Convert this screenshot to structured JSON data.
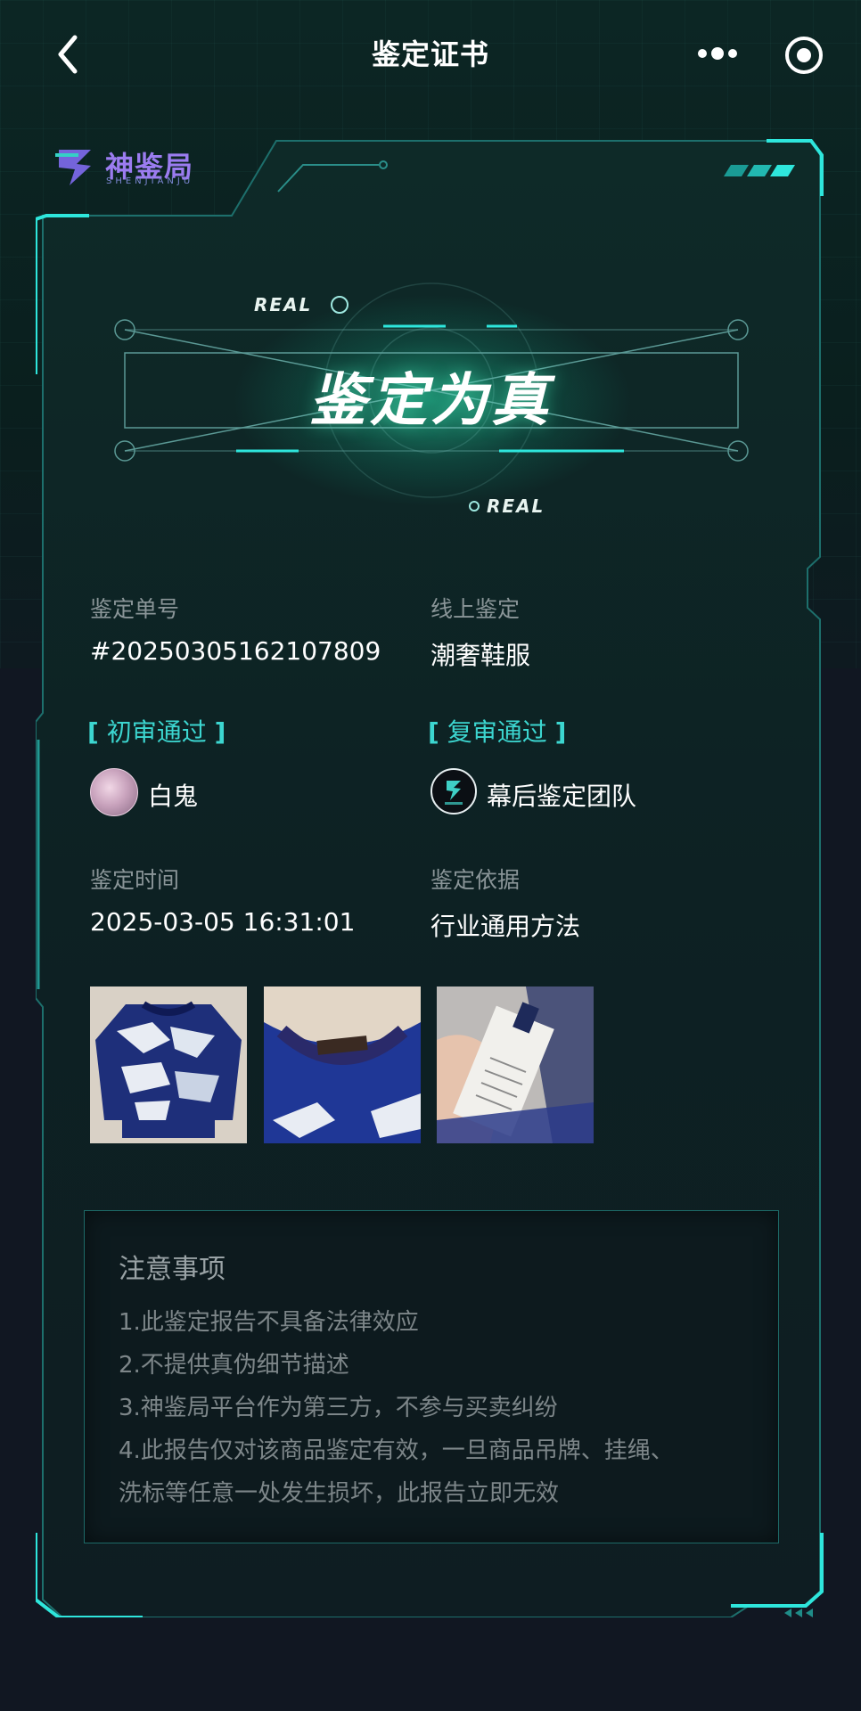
{
  "nav": {
    "title": "鉴定证书",
    "back_icon": "chevron-left-icon",
    "more_icon": "more-dots-icon",
    "target_icon": "target-circle-icon"
  },
  "brand": {
    "name": "神鉴局",
    "sub": "SHENJIANJU"
  },
  "result": {
    "title": "鉴定为真",
    "tag_top": "REAL",
    "tag_bottom": "REAL"
  },
  "fields": {
    "order_label": "鉴定单号",
    "order_value": "#20250305162107809",
    "category_label": "线上鉴定",
    "category_value": "潮奢鞋服",
    "first_review_label": "初审通过",
    "first_reviewer": "白鬼",
    "second_review_label": "复审通过",
    "second_reviewer": "幕后鉴定团队",
    "time_label": "鉴定时间",
    "time_value": "2025-03-05 16:31:01",
    "basis_label": "鉴定依据",
    "basis_value": "行业通用方法"
  },
  "photos": [
    "sweater-front-photo",
    "sweater-collar-photo",
    "care-label-photo"
  ],
  "notes": {
    "title": "注意事项",
    "items": [
      "1.此鉴定报告不具备法律效应",
      "2.不提供真伪细节描述",
      "3.神鉴局平台作为第三方，不参与买卖纠纷",
      "4.此报告仅对该商品鉴定有效，一旦商品吊牌、挂绳、",
      "洗标等任意一处发生损坏，此报告立即无效"
    ]
  },
  "colors": {
    "accent": "#3cd6d0",
    "frame": "#23c7c2",
    "background": "#111722"
  }
}
